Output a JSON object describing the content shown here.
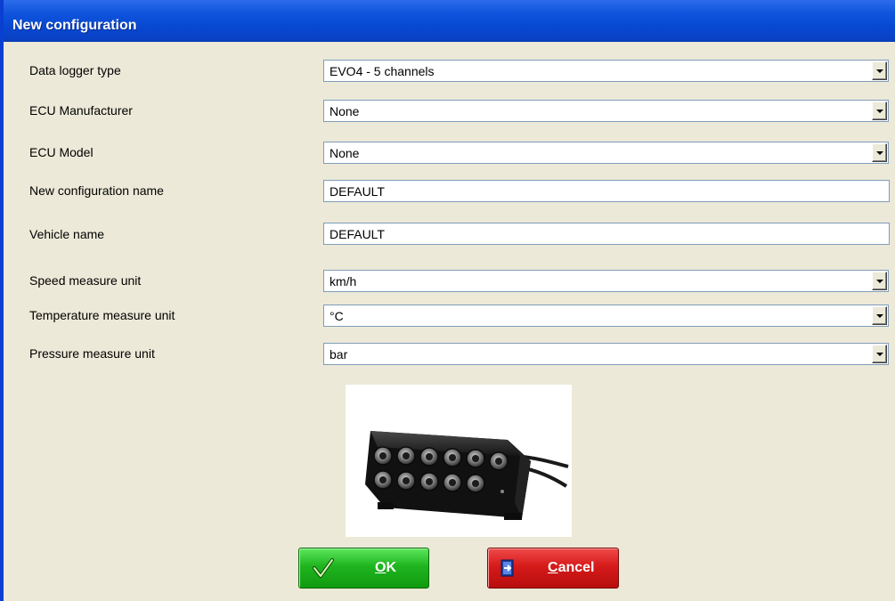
{
  "window": {
    "title": "New configuration"
  },
  "form": {
    "data_logger_type": {
      "label": "Data logger type",
      "value": "EVO4 - 5 channels"
    },
    "ecu_manufacturer": {
      "label": "ECU Manufacturer",
      "value": "None"
    },
    "ecu_model": {
      "label": "ECU Model",
      "value": "None"
    },
    "config_name": {
      "label": "New configuration name",
      "value": "DEFAULT"
    },
    "vehicle_name": {
      "label": "Vehicle name",
      "value": "DEFAULT"
    },
    "speed_unit": {
      "label": "Speed measure unit",
      "value": "km/h"
    },
    "temperature_unit": {
      "label": "Temperature measure unit",
      "value": "°C"
    },
    "pressure_unit": {
      "label": "Pressure measure unit",
      "value": "bar"
    }
  },
  "buttons": {
    "ok": {
      "mnemonic": "O",
      "rest": "K",
      "icon": "checkmark-icon"
    },
    "cancel": {
      "mnemonic": "C",
      "rest": "ancel",
      "icon": "exit-door-icon"
    }
  },
  "image": {
    "icon": "data-logger-device-image"
  },
  "colors": {
    "titlebar": "#0E52DC",
    "background": "#ECE9D8",
    "ok_button": "#1FB51F",
    "cancel_button": "#D61A1A"
  }
}
